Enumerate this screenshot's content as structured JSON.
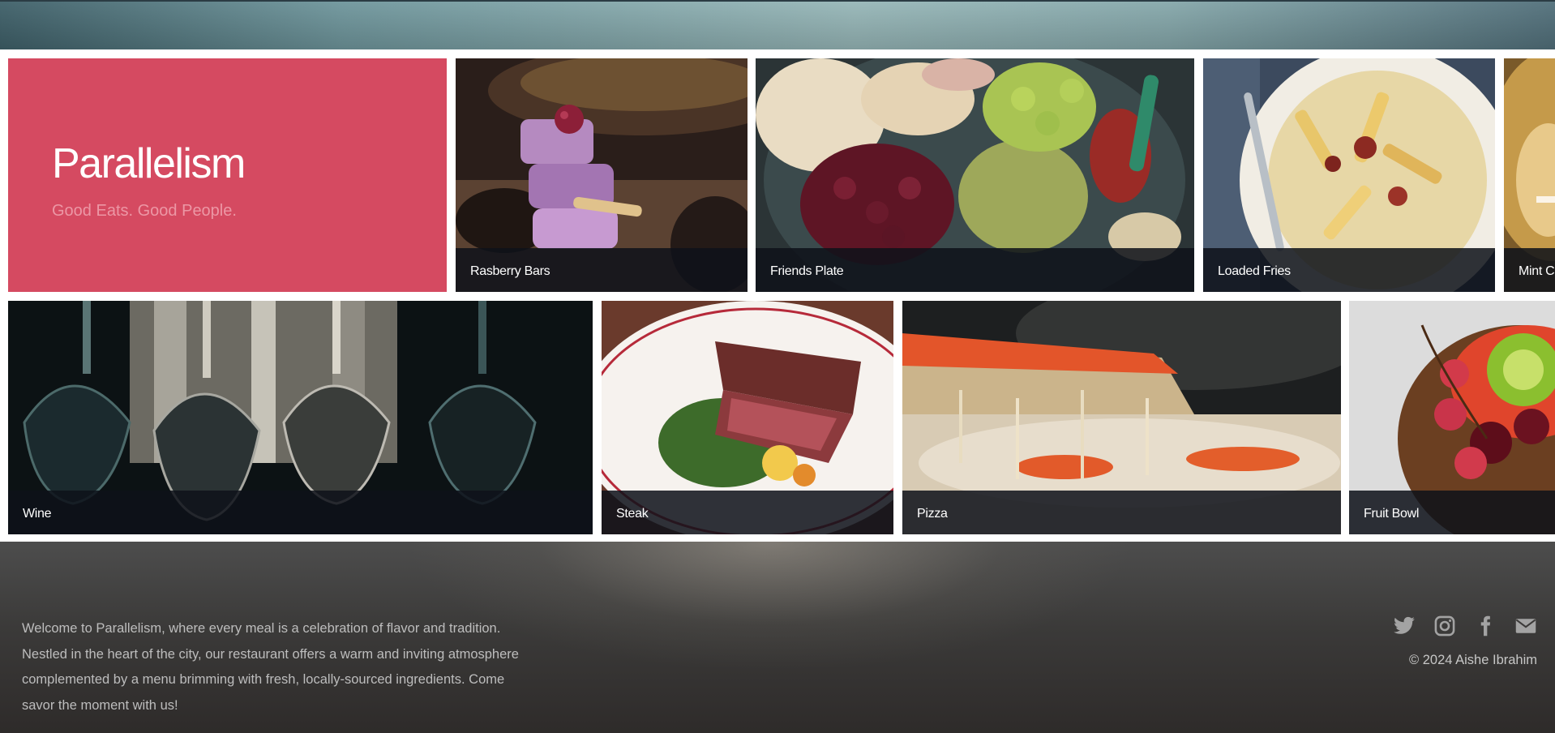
{
  "brand": {
    "title": "Parallelism",
    "tagline": "Good Eats. Good People."
  },
  "gallery": {
    "tiles": [
      {
        "caption": "Rasberry Bars"
      },
      {
        "caption": "Friends Plate"
      },
      {
        "caption": "Loaded Fries"
      },
      {
        "caption": "Mint Cr"
      },
      {
        "caption": "Wine"
      },
      {
        "caption": "Steak"
      },
      {
        "caption": "Pizza"
      },
      {
        "caption": "Fruit Bowl"
      }
    ]
  },
  "footer": {
    "about": "Welcome to Parallelism, where every meal is a celebration of flavor and tradition. Nestled in the heart of the city, our restaurant offers a warm and inviting atmosphere complemented by a menu brimming with fresh, locally-sourced ingredients. Come savor the moment with us!",
    "social": [
      {
        "icon": "twitter-icon"
      },
      {
        "icon": "instagram-icon"
      },
      {
        "icon": "facebook-icon"
      },
      {
        "icon": "email-icon"
      }
    ],
    "copyright": "© 2024 Aishe Ibrahim"
  },
  "colors": {
    "brand_card": "#d54a61",
    "tagline": "#ec97a5",
    "caption_bar": "#0e121a",
    "footer_text": "#bdbdbd"
  }
}
